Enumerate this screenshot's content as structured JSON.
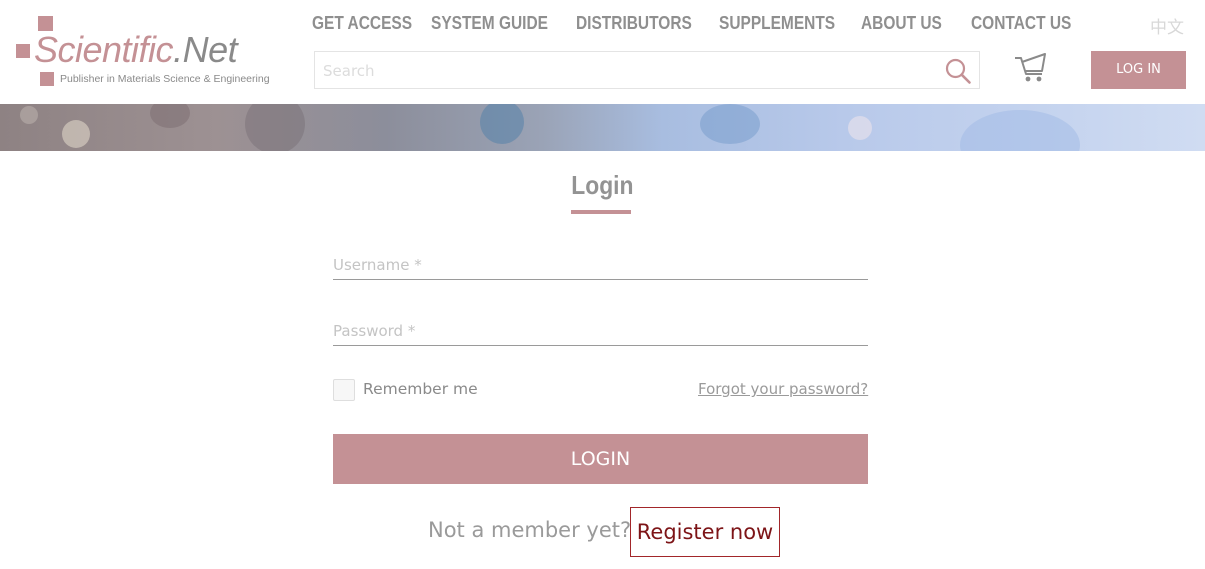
{
  "logo": {
    "name_part1": "Scientific",
    "name_part2": ".Net",
    "tagline": "Publisher in Materials Science & Engineering"
  },
  "nav": {
    "items": [
      {
        "label": "GET ACCESS"
      },
      {
        "label": "SYSTEM GUIDE"
      },
      {
        "label": "DISTRIBUTORS"
      },
      {
        "label": "SUPPLEMENTS"
      },
      {
        "label": "ABOUT US"
      },
      {
        "label": "CONTACT US"
      }
    ],
    "language": "中文"
  },
  "search": {
    "placeholder": "Search",
    "icon": "search-icon"
  },
  "header": {
    "cart_icon": "cart-icon",
    "login_label": "LOG IN"
  },
  "form": {
    "title": "Login",
    "username_placeholder": "Username *",
    "password_placeholder": "Password *",
    "remember_label": "Remember me",
    "forgot_label": "Forgot your password?",
    "submit_label": "LOGIN",
    "not_member_text": "Not a member yet?",
    "register_label": "Register now"
  },
  "colors": {
    "accent": "#c49195",
    "register_border": "#a2262a",
    "register_text": "#7d1417",
    "nav_text": "#8f8f8f"
  }
}
